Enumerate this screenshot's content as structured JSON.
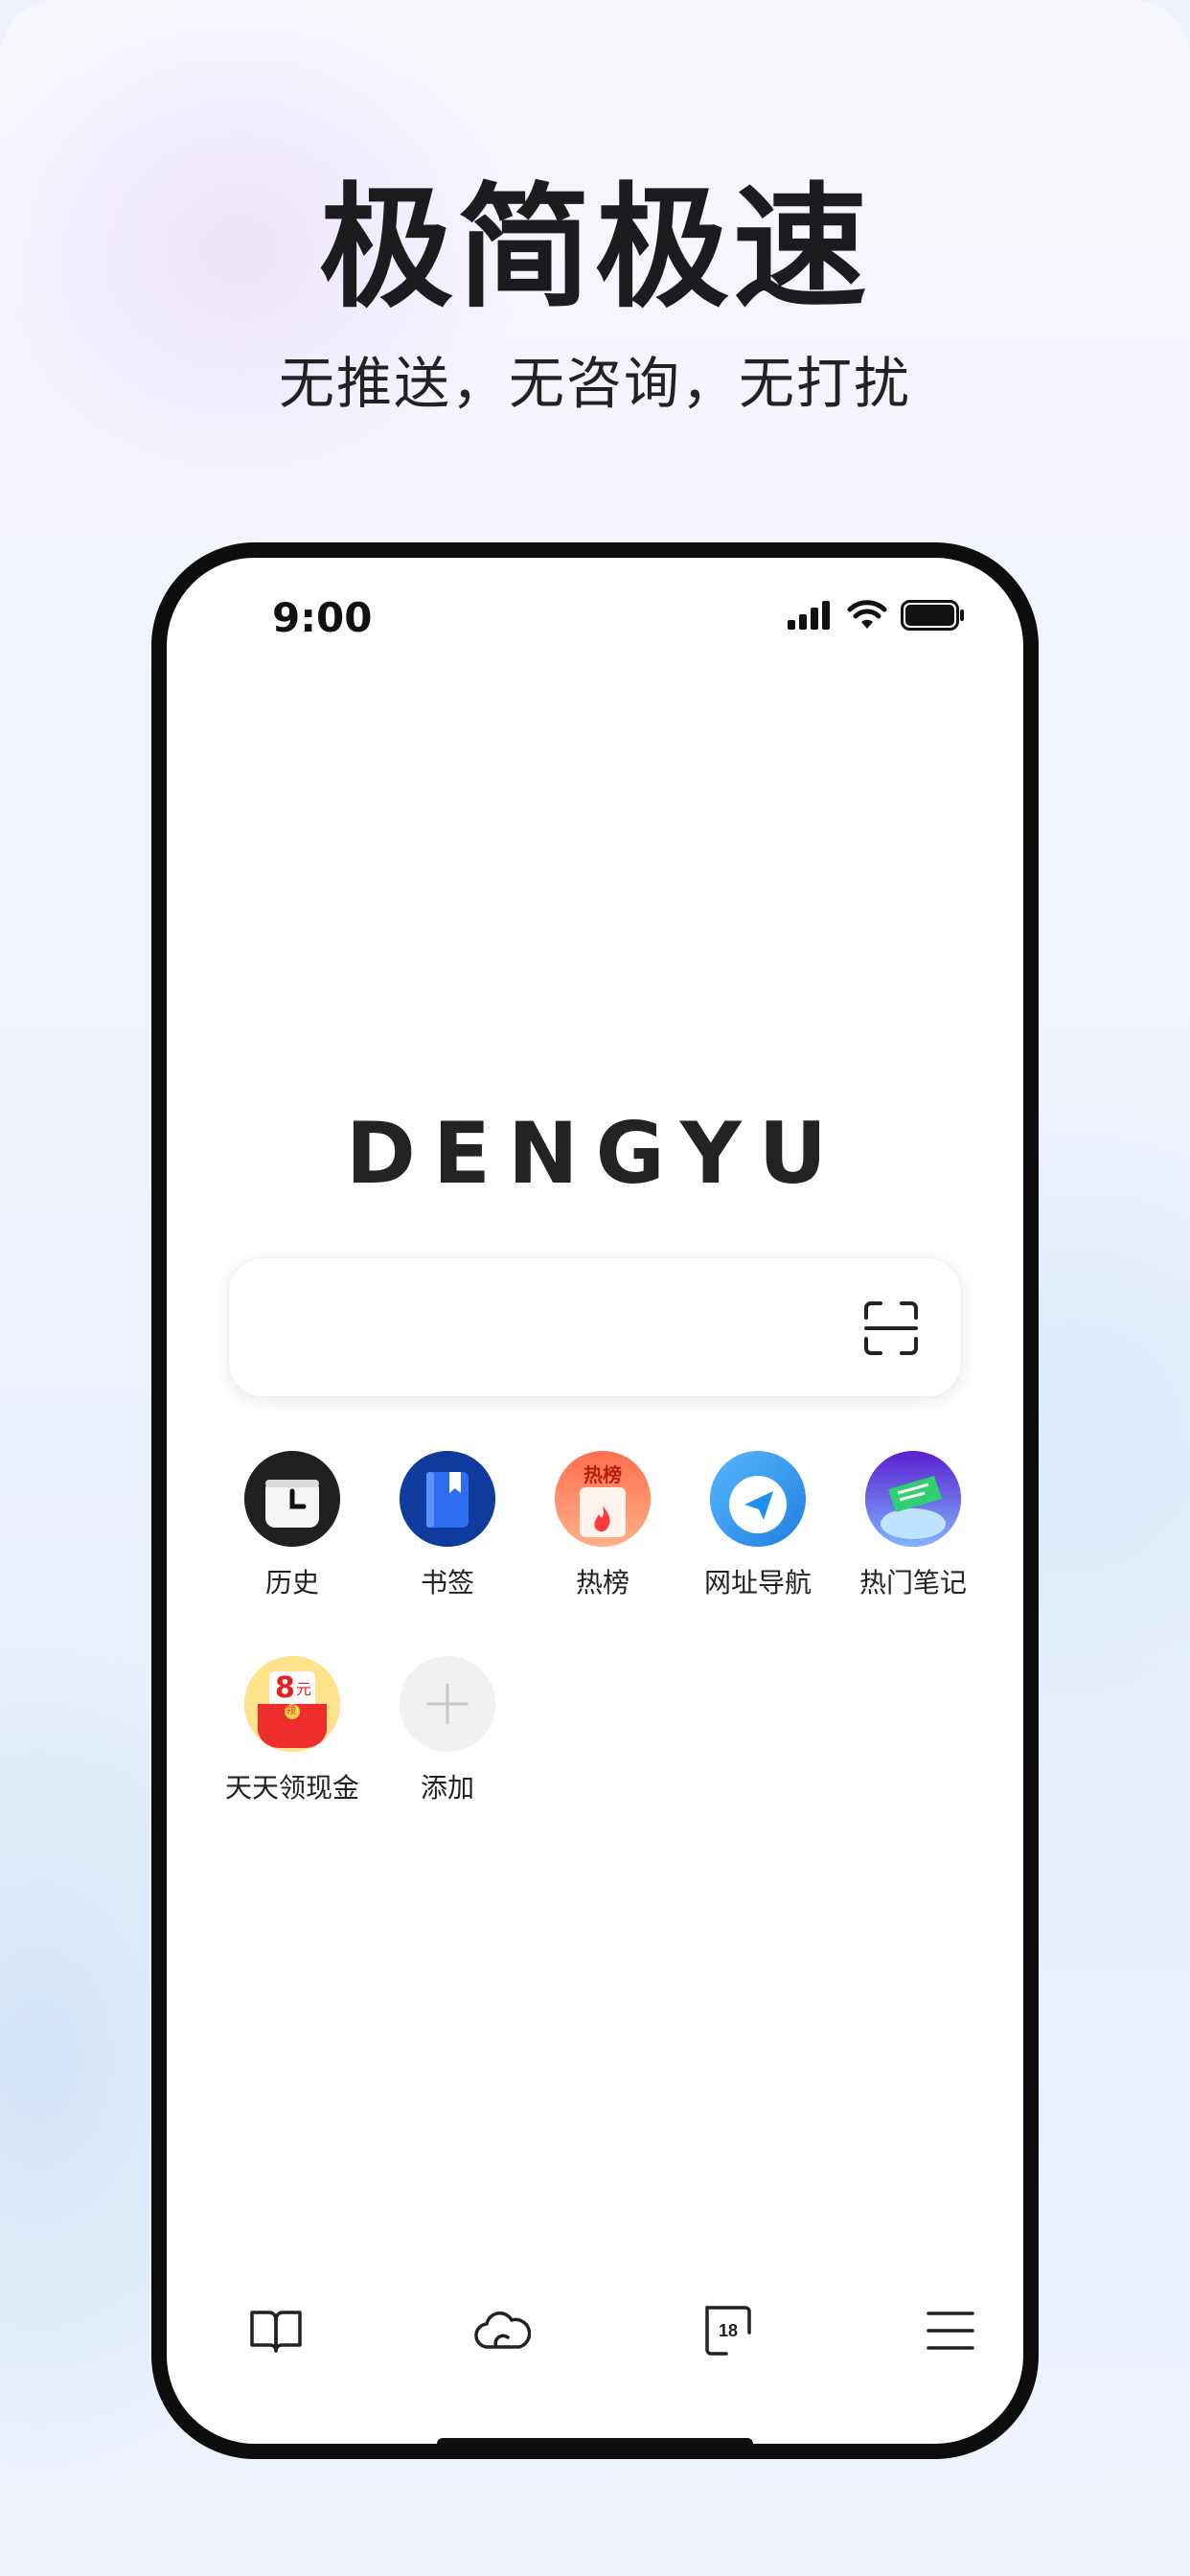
{
  "hero": {
    "title": "极简极速",
    "subtitle": "无推送，无咨询，无打扰"
  },
  "status_bar": {
    "time": "9:00",
    "icons": [
      "signal-icon",
      "wifi-icon",
      "battery-icon"
    ]
  },
  "logo": {
    "text": "DENGYU"
  },
  "search": {
    "placeholder": "",
    "scan_icon": "scan-icon"
  },
  "shortcuts": [
    {
      "label": "历史",
      "icon": "clock-icon"
    },
    {
      "label": "书签",
      "icon": "bookmark-book-icon"
    },
    {
      "label": "热榜",
      "icon": "hot-list-icon"
    },
    {
      "label": "网址导航",
      "icon": "navigation-arrow-icon"
    },
    {
      "label": "热门笔记",
      "icon": "notes-icon"
    },
    {
      "label": "天天领现金",
      "icon": "cash-envelope-icon"
    },
    {
      "label": "添加",
      "icon": "add-icon"
    }
  ],
  "cash_badge": {
    "amount": "8",
    "unit": "元",
    "tag": "领"
  },
  "hot_badge": "热榜",
  "bottom_nav": {
    "items": [
      "book-icon",
      "cloud-icon",
      "tabs-icon",
      "menu-icon"
    ],
    "tab_count": "18"
  },
  "colors": {
    "frame": "#0d0d0d",
    "text": "#1c1c1e",
    "history_bg": "#222222",
    "bookmark_bg": "#1a4fd6",
    "hot_bg": "#ff7a55",
    "nav_bg": "#3ba0f5",
    "notes_bg": "#6a2bd8",
    "cash_bg": "#ffd96a",
    "add_bg": "#f1f1f1"
  }
}
